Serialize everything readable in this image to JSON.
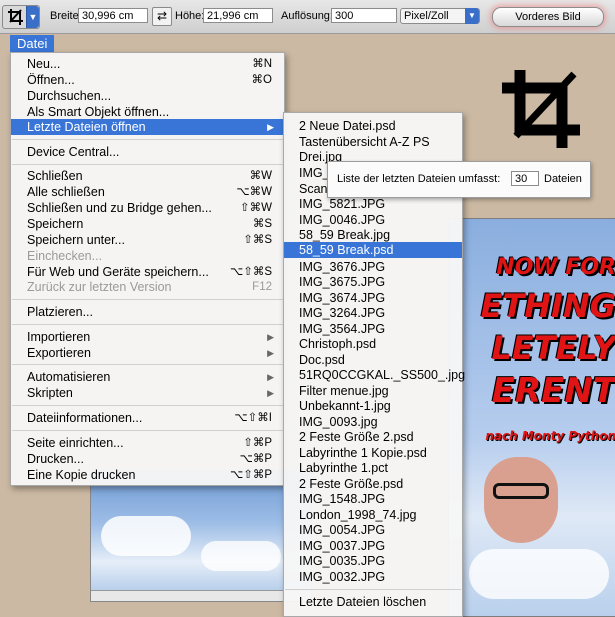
{
  "options_bar": {
    "width_label": "Breite:",
    "width_value": "30,996 cm",
    "height_label": "Höhe:",
    "height_value": "21,996 cm",
    "resolution_label": "Auflösung:",
    "resolution_value": "300",
    "unit_value": "Pixel/Zoll",
    "front_image_label": "Vorderes Bild"
  },
  "menu_title": "Datei",
  "menu": [
    {
      "label": "Neu...",
      "shortcut": "⌘N"
    },
    {
      "label": "Öffnen...",
      "shortcut": "⌘O"
    },
    {
      "label": "Durchsuchen...",
      "shortcut": ""
    },
    {
      "label": "Als Smart Objekt öffnen...",
      "shortcut": ""
    },
    {
      "label": "Letzte Dateien öffnen",
      "shortcut": ""
    },
    {
      "label": "Device Central...",
      "shortcut": ""
    },
    {
      "label": "Schließen",
      "shortcut": "⌘W"
    },
    {
      "label": "Alle schließen",
      "shortcut": "⌥⌘W"
    },
    {
      "label": "Schließen und zu Bridge gehen...",
      "shortcut": "⇧⌘W"
    },
    {
      "label": "Speichern",
      "shortcut": "⌘S"
    },
    {
      "label": "Speichern unter...",
      "shortcut": "⇧⌘S"
    },
    {
      "label": "Einchecken...",
      "shortcut": ""
    },
    {
      "label": "Für Web und Geräte speichern...",
      "shortcut": "⌥⇧⌘S"
    },
    {
      "label": "Zurück zur letzten Version",
      "shortcut": "F12"
    },
    {
      "label": "Platzieren...",
      "shortcut": ""
    },
    {
      "label": "Importieren",
      "shortcut": ""
    },
    {
      "label": "Exportieren",
      "shortcut": ""
    },
    {
      "label": "Automatisieren",
      "shortcut": ""
    },
    {
      "label": "Skripten",
      "shortcut": ""
    },
    {
      "label": "Dateiinformationen...",
      "shortcut": "⌥⇧⌘I"
    },
    {
      "label": "Seite einrichten...",
      "shortcut": "⇧⌘P"
    },
    {
      "label": "Drucken...",
      "shortcut": "⌥⌘P"
    },
    {
      "label": "Eine Kopie drucken",
      "shortcut": "⌥⇧⌘P"
    }
  ],
  "recent_files": [
    "2 Neue Datei.psd",
    "Tastenübersicht A-Z PS",
    "Drei.jpg",
    "IMG_0",
    "Scan_",
    "IMG_5821.JPG",
    "IMG_0046.JPG",
    "58_59 Break.jpg",
    "58_59 Break.psd",
    "IMG_3676.JPG",
    "IMG_3675.JPG",
    "IMG_3674.JPG",
    "IMG_3264.JPG",
    "IMG_3564.JPG",
    "Christoph.psd",
    "Doc.psd",
    "51RQ0CCGKAL._SS500_.jpg",
    "Filter menue.jpg",
    "Unbekannt-1.jpg",
    "IMG_0093.jpg",
    "2 Feste Größe 2.psd",
    "Labyrinthe 1 Kopie.psd",
    "Labyrinthe 1.pct",
    "2 Feste Größe.psd",
    "IMG_1548.JPG",
    "London_1998_74.jpg",
    "IMG_0054.JPG",
    "IMG_0037.JPG",
    "IMG_0035.JPG",
    "IMG_0032.JPG"
  ],
  "clear_recent": "Letzte Dateien löschen",
  "tooltip": {
    "label": "Liste der letzten Dateien umfasst:",
    "value": "30",
    "unit": "Dateien"
  },
  "poster": {
    "line1": "NOW FOR",
    "line2": "ETHING",
    "line3": "LETELY",
    "line4": "ERENT",
    "byline": "nach Monty Python"
  },
  "colors": {
    "highlight": "#3875d7",
    "poster_text": "#e01414"
  }
}
